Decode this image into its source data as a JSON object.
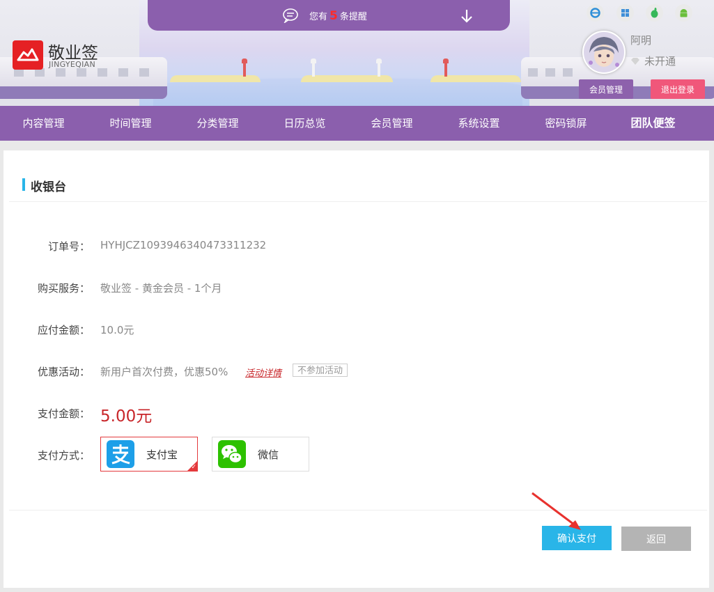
{
  "notice": {
    "prefix": "您有",
    "count": "5",
    "suffix": "条提醒"
  },
  "brand": {
    "name": "敬业签",
    "pinyin": "JINGYEQIAN",
    "logo_color": "#e52124"
  },
  "platform_icons": [
    "ie-icon",
    "windows-icon",
    "apple-icon",
    "android-icon"
  ],
  "user": {
    "name": "阿明",
    "status": "未开通",
    "member_button": "会员管理",
    "logout_button": "退出登录"
  },
  "nav": {
    "items": [
      {
        "label": "内容管理"
      },
      {
        "label": "时间管理"
      },
      {
        "label": "分类管理"
      },
      {
        "label": "日历总览"
      },
      {
        "label": "会员管理"
      },
      {
        "label": "系统设置"
      },
      {
        "label": "密码锁屏"
      },
      {
        "label": "团队便签"
      }
    ]
  },
  "cashier": {
    "title": "收银台",
    "order_label": "订单号：",
    "order_value": "HYHJCZ1093946340473311232",
    "service_label": "购买服务：",
    "service_value": "敬业签 - 黄金会员 - 1个月",
    "due_label": "应付金额：",
    "due_value": "10.0元",
    "promo_label": "优惠活动：",
    "promo_value": "新用户首次付费，优惠50%",
    "promo_link": "活动详情",
    "promo_optout": "不参加活动",
    "pay_amount_label": "支付金额：",
    "pay_amount_value": "5.00元",
    "method_label": "支付方式：",
    "methods": [
      {
        "label": "支付宝",
        "icon": "alipay-icon",
        "selected": true
      },
      {
        "label": "微信",
        "icon": "wechat-icon",
        "selected": false
      }
    ],
    "confirm_button": "确认支付",
    "back_button": "返回"
  },
  "colors": {
    "brand_purple": "#8b5fad",
    "accent_blue": "#29b5e8",
    "logout_pink": "#f0577a",
    "price_red": "#c8262a"
  }
}
